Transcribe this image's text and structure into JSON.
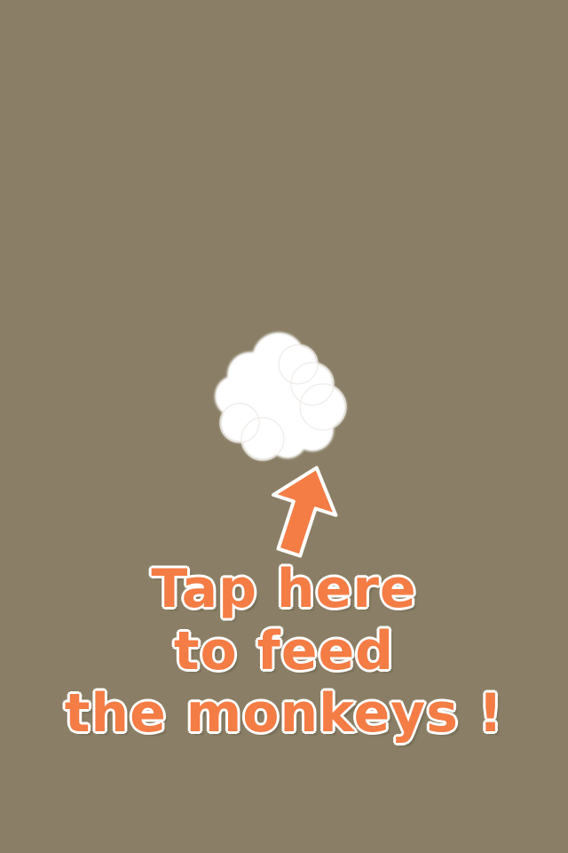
{
  "scene": {
    "background_color": "#8a7f66",
    "tap_target": {
      "icon": "cloud-food-icon",
      "color": "#ffffff"
    },
    "pointer": {
      "icon": "up-arrow-icon",
      "color": "#f47c45"
    },
    "hint": {
      "lines": [
        "Tap here",
        "to feed",
        "the monkeys !"
      ],
      "color": "#f47c45",
      "outline_color": "#ffffff"
    }
  }
}
